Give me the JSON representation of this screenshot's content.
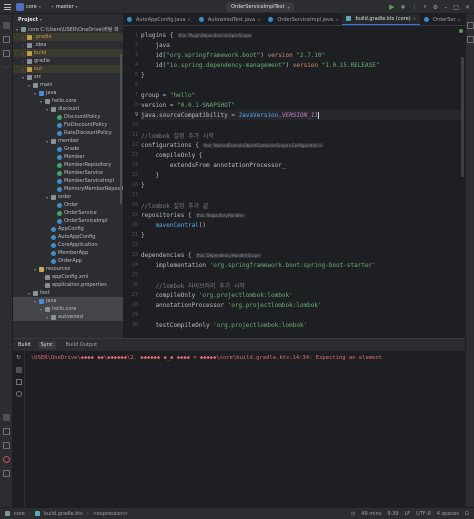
{
  "topbar": {
    "project_badge": "C",
    "project_name": "core",
    "branch": "master",
    "run_config": "OrderServiceImplTest"
  },
  "project_panel": {
    "title": "Project",
    "tree": [
      {
        "label": "core  C:\\Users\\USER\\OneDrive\\바탕 화",
        "icon": "dir",
        "depth": 0,
        "arrow": "▾"
      },
      {
        "label": ".gradle",
        "icon": "dir-exc",
        "depth": 1,
        "arrow": "›",
        "state": "exc"
      },
      {
        "label": ".idea",
        "icon": "dir",
        "depth": 1,
        "arrow": "›"
      },
      {
        "label": "build",
        "icon": "dir-exc",
        "depth": 1,
        "arrow": "›",
        "state": "exc"
      },
      {
        "label": "gradle",
        "icon": "dir",
        "depth": 1,
        "arrow": "›"
      },
      {
        "label": "out",
        "icon": "dir-exc",
        "depth": 1,
        "arrow": "›",
        "state": "exc"
      },
      {
        "label": "src",
        "icon": "dir",
        "depth": 1,
        "arrow": "▾"
      },
      {
        "label": "main",
        "icon": "dir",
        "depth": 2,
        "arrow": "▾"
      },
      {
        "label": "java",
        "icon": "dir-src",
        "depth": 3,
        "arrow": "▾"
      },
      {
        "label": "hello.core",
        "icon": "dir",
        "depth": 4,
        "arrow": "▾"
      },
      {
        "label": "discount",
        "icon": "dir",
        "depth": 5,
        "arrow": "▾"
      },
      {
        "label": "DiscountPolicy",
        "icon": "cls-int",
        "depth": 6
      },
      {
        "label": "FixDiscountPolicy",
        "icon": "cls",
        "depth": 6
      },
      {
        "label": "RateDiscountPolicy",
        "icon": "cls",
        "depth": 6
      },
      {
        "label": "member",
        "icon": "dir",
        "depth": 5,
        "arrow": "▾"
      },
      {
        "label": "Grade",
        "icon": "cls",
        "depth": 6
      },
      {
        "label": "Member",
        "icon": "cls",
        "depth": 6
      },
      {
        "label": "MemberRepository",
        "icon": "cls-int",
        "depth": 6
      },
      {
        "label": "MemberService",
        "icon": "cls-int",
        "depth": 6
      },
      {
        "label": "MemberServiceImpl",
        "icon": "cls",
        "depth": 6
      },
      {
        "label": "MemoryMemberRepository",
        "icon": "cls",
        "depth": 6
      },
      {
        "label": "order",
        "icon": "dir",
        "depth": 5,
        "arrow": "▾"
      },
      {
        "label": "Order",
        "icon": "cls",
        "depth": 6
      },
      {
        "label": "OrderService",
        "icon": "cls-int",
        "depth": 6
      },
      {
        "label": "OrderServiceImpl",
        "icon": "cls",
        "depth": 6
      },
      {
        "label": "AppConfig",
        "icon": "cls",
        "depth": 5
      },
      {
        "label": "AutoAppConfig",
        "icon": "cls",
        "depth": 5
      },
      {
        "label": "CoreApplication",
        "icon": "cls",
        "depth": 5
      },
      {
        "label": "MemberApp",
        "icon": "cls",
        "depth": 5
      },
      {
        "label": "OrderApp",
        "icon": "cls",
        "depth": 5
      },
      {
        "label": "resources",
        "icon": "dir-res",
        "depth": 3,
        "arrow": "▾"
      },
      {
        "label": "appConfig.xml",
        "icon": "pfile",
        "depth": 4
      },
      {
        "label": "application.properties",
        "icon": "pfile",
        "depth": 4
      },
      {
        "label": "test",
        "icon": "dir",
        "depth": 2,
        "arrow": "▾"
      },
      {
        "label": "java",
        "icon": "dir-src",
        "depth": 3,
        "arrow": "▾",
        "state": "sel"
      },
      {
        "label": "hello.core",
        "icon": "dir",
        "depth": 4,
        "arrow": "▾",
        "state": "sel"
      },
      {
        "label": "autowired",
        "icon": "dir",
        "depth": 5,
        "arrow": "▾",
        "state": "sel"
      }
    ]
  },
  "tabs": [
    {
      "label": "AutoAppConfig.java",
      "icon": "cls"
    },
    {
      "label": "AutowiredTest.java",
      "icon": "cls"
    },
    {
      "label": "OrderServiceImpl.java",
      "icon": "cls"
    },
    {
      "label": "build.gradle.kts (core)",
      "icon": "gfile",
      "active": true
    },
    {
      "label": "OrderSer",
      "icon": "cls"
    }
  ],
  "editor": {
    "current_line": 9,
    "lines": [
      {
        "n": "1",
        "tokens": [
          {
            "t": "plugins ",
            "c": "ident"
          },
          {
            "t": "{",
            "c": "ident"
          }
        ],
        "hint": "this: PluginDependenciesSpecScope"
      },
      {
        "n": "2",
        "tokens": [
          {
            "t": "    java",
            "c": "ident"
          }
        ]
      },
      {
        "n": "3",
        "tokens": [
          {
            "t": "    id(",
            "c": "ident"
          },
          {
            "t": "\"org.springframework.boot\"",
            "c": "s"
          },
          {
            "t": ") ",
            "c": "ident"
          },
          {
            "t": "version",
            "c": "k"
          },
          {
            "t": " ",
            "c": "ident"
          },
          {
            "t": "\"2.7.10\"",
            "c": "s"
          }
        ]
      },
      {
        "n": "4",
        "tokens": [
          {
            "t": "    id(",
            "c": "ident"
          },
          {
            "t": "\"io.spring.dependency-management\"",
            "c": "s"
          },
          {
            "t": ") ",
            "c": "ident"
          },
          {
            "t": "version",
            "c": "k"
          },
          {
            "t": " ",
            "c": "ident"
          },
          {
            "t": "\"1.0.15.RELEASE\"",
            "c": "s"
          }
        ]
      },
      {
        "n": "5",
        "tokens": [
          {
            "t": "}",
            "c": "ident"
          }
        ]
      },
      {
        "n": "6",
        "tokens": []
      },
      {
        "n": "7",
        "tokens": [
          {
            "t": "group",
            "c": "ident"
          },
          {
            "t": " = ",
            "c": "ident"
          },
          {
            "t": "\"hello\"",
            "c": "s"
          }
        ]
      },
      {
        "n": "8",
        "tokens": [
          {
            "t": "version",
            "c": "ident"
          },
          {
            "t": " = ",
            "c": "ident"
          },
          {
            "t": "\"0.0.1-SNAPSHOT\"",
            "c": "s"
          }
        ]
      },
      {
        "n": "9",
        "tokens": [
          {
            "t": "java.sourceCompatibility",
            "c": "ident"
          },
          {
            "t": " = ",
            "c": "ident"
          },
          {
            "t": "JavaVersion.",
            "c": "f"
          },
          {
            "t": "VERSION_11",
            "c": "ital"
          }
        ]
      },
      {
        "n": "10",
        "tokens": []
      },
      {
        "n": "11",
        "tokens": [
          {
            "t": "//lombok 설정 추가 시작",
            "c": "cm"
          }
        ]
      },
      {
        "n": "12",
        "tokens": [
          {
            "t": "configurations ",
            "c": "ident"
          },
          {
            "t": "{",
            "c": "ident"
          }
        ],
        "hint": "this: NamedDomainObjectContainerScope<Configuration>"
      },
      {
        "n": "13",
        "tokens": [
          {
            "t": "    compileOnly ",
            "c": "ident"
          },
          {
            "t": "{",
            "c": "ident"
          }
        ]
      },
      {
        "n": "14",
        "tokens": [
          {
            "t": "        extendsFrom",
            "c": "ident"
          },
          {
            "t": " annotationProcessor",
            "c": "ident"
          },
          {
            "t": "_",
            "c": "ident"
          }
        ]
      },
      {
        "n": "15",
        "tokens": [
          {
            "t": "    }",
            "c": "ident"
          }
        ]
      },
      {
        "n": "16",
        "tokens": [
          {
            "t": "}",
            "c": "ident"
          }
        ]
      },
      {
        "n": "17",
        "tokens": []
      },
      {
        "n": "18",
        "tokens": [
          {
            "t": "//lombok 설정 추가 끝",
            "c": "cm"
          }
        ]
      },
      {
        "n": "19",
        "tokens": [
          {
            "t": "repositories ",
            "c": "ident"
          },
          {
            "t": "{",
            "c": "ident"
          }
        ],
        "hint": "this: RepositoryHandler"
      },
      {
        "n": "20",
        "tokens": [
          {
            "t": "    mavenCentral",
            "c": "f"
          },
          {
            "t": "()",
            "c": "ident"
          }
        ]
      },
      {
        "n": "21",
        "tokens": [
          {
            "t": "}",
            "c": "ident"
          }
        ]
      },
      {
        "n": "22",
        "tokens": []
      },
      {
        "n": "23",
        "tokens": [
          {
            "t": "dependencies ",
            "c": "ident"
          },
          {
            "t": "{",
            "c": "ident"
          }
        ],
        "hint": "this: DependencyHandlerScope"
      },
      {
        "n": "24",
        "tokens": [
          {
            "t": "    implementation ",
            "c": "ident"
          },
          {
            "t": "'org.springframework.boot:spring-boot-starter'",
            "c": "s"
          }
        ]
      },
      {
        "n": "25",
        "tokens": []
      },
      {
        "n": "26",
        "tokens": [
          {
            "t": "    //lombok 라이브러리 추가 시작",
            "c": "cm"
          }
        ]
      },
      {
        "n": "27",
        "tokens": [
          {
            "t": "    compileOnly ",
            "c": "ident"
          },
          {
            "t": "'org.projectlombok:lombok'",
            "c": "s"
          }
        ]
      },
      {
        "n": "28",
        "tokens": [
          {
            "t": "    annotationProcessor ",
            "c": "ident"
          },
          {
            "t": "'org.projectlombok:lombok'",
            "c": "s"
          }
        ]
      },
      {
        "n": "29",
        "tokens": []
      },
      {
        "n": "30",
        "tokens": [
          {
            "t": "    testCompileOnly ",
            "c": "ident"
          },
          {
            "t": "'org.projectlombok:lombok'",
            "c": "s"
          }
        ]
      }
    ]
  },
  "build_window": {
    "title": "Build",
    "tabs": [
      "Sync",
      "Build Output"
    ],
    "active_tab": "Sync",
    "error_line": "\\USER\\OneDrive\\◆◆◆◆ ◆◆\\◆◆◆◆◆◆\\2. ◆◆◆◆◆◆ ◆_◆ ◆◆◆◆ = ◆◆◆◆◆\\core\\build.gradle.kts:14:34: Expecting an element"
  },
  "status_bar": {
    "crumbs": [
      "core",
      "build.gradle.kts",
      "<expression>"
    ],
    "position": "49 mins",
    "cursor": "9:39",
    "line_sep": "LF",
    "encoding": "UTF-8",
    "indent": "4 spaces"
  },
  "colors": {
    "accent": "#3574f0",
    "error": "#e06c75",
    "string": "#6aab73",
    "keyword": "#cf8e6d"
  }
}
